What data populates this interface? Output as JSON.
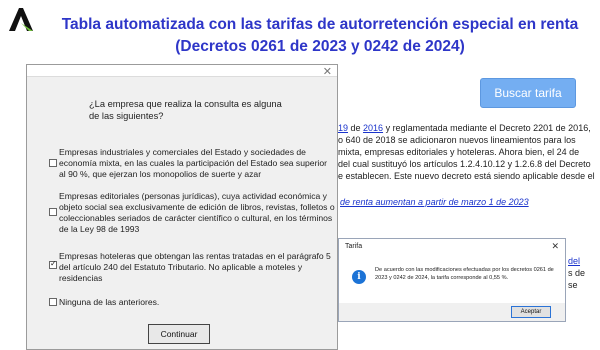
{
  "header": {
    "title_line1": "Tabla automatizada con las tarifas de autorretención especial en renta",
    "title_line2": "(Decretos 0261 de 2023 y 0242 de 2024)"
  },
  "page": {
    "buscar_label": "Buscar tarifa",
    "para1": {
      "link1": "19",
      "sep": " de ",
      "link2": "2016",
      "rest": " y reglamentada mediante el Decreto 2201 de 2016,",
      "line2": "o 640 de 2018 se adicionaron nuevos lineamientos para los",
      "line3": "mixta, empresas editoriales y hoteleras. Ahora bien, el 24 de",
      "line4": "del cual sustituyó los artículos 1.2.4.10.12 y 1.2.6.8 del Decreto",
      "line5": "e establecen. Este nuevo decreto está siendo aplicable desde el"
    },
    "link_line": "de renta aumentan a partir de marzo 1 de 2023",
    "edge1": "del",
    "edge2": "s de",
    "edge3": "se"
  },
  "dialog": {
    "close_glyph": "✕",
    "question": "¿La empresa que realiza la consulta es alguna de las siguientes?",
    "options": [
      {
        "label": "Empresas industriales y comerciales del Estado y sociedades de economía mixta, en las cuales la participación del Estado sea superior al 90 %, que ejerzan los monopolios de suerte y azar",
        "checked": false
      },
      {
        "label": "Empresas editoriales (personas jurídicas), cuya actividad económica y objeto social sea exclusivamente de edición de libros, revistas, folletos o coleccionables seriados de carácter científico o cultural, en los términos de la Ley 98 de 1993",
        "checked": false
      },
      {
        "label": "Empresas hoteleras que obtengan las rentas tratadas en el parágrafo 5 del artículo 240 del Estatuto Tributario. No aplicable a moteles y residencias",
        "checked": true
      },
      {
        "label": "Ninguna de las anteriores.",
        "checked": false
      }
    ],
    "continue_label": "Continuar"
  },
  "msgbox": {
    "title": "Tarifa",
    "close_glyph": "✕",
    "icon": "info-icon",
    "icon_glyph": "i",
    "text": "De acuerdo con las modificaciones efectuadas por los decretos 0261 de 2023 y 0242 de 2024, la tarifa corresponde al 0,55 %.",
    "ok_label": "Aceptar"
  },
  "colors": {
    "title": "#2e36c8",
    "button": "#74aef2",
    "link": "#1a33cc",
    "info": "#1c73d6"
  }
}
